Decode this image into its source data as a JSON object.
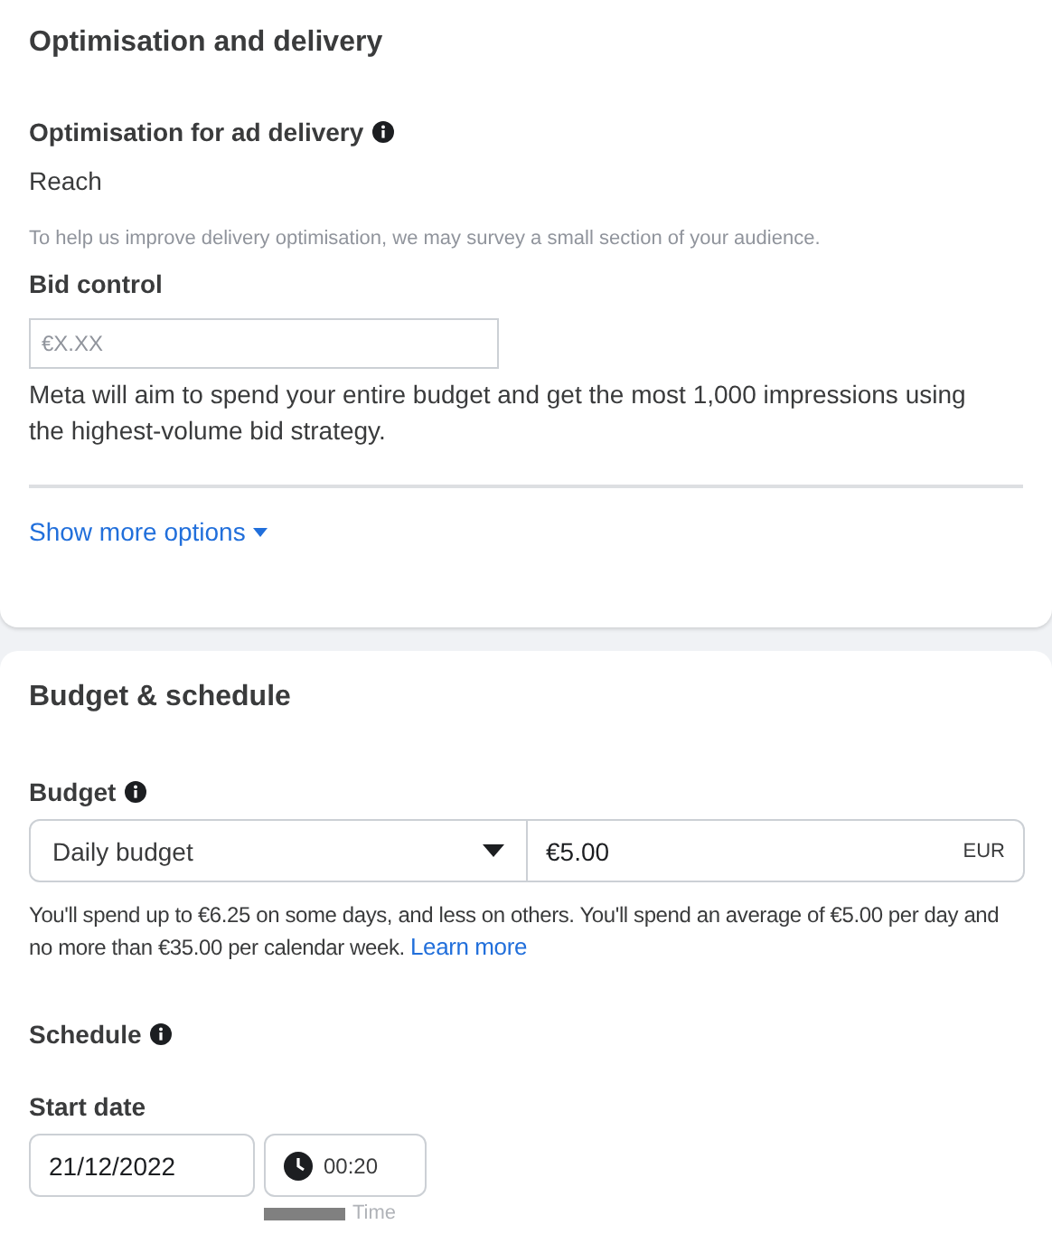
{
  "optimisation": {
    "title": "Optimisation and delivery",
    "goal_label": "Optimisation for ad delivery",
    "goal_value": "Reach",
    "survey_note": "To help us improve delivery optimisation, we may survey a small section of your audience.",
    "bid_label": "Bid control",
    "bid_placeholder": "€X.XX",
    "bid_description": "Meta will aim to spend your entire budget and get the most 1,000 impressions using the highest-volume bid strategy.",
    "more_link": "Show more options"
  },
  "budget_schedule": {
    "title": "Budget & schedule",
    "budget_label": "Budget",
    "budget_type": "Daily budget",
    "amount": "€5.00",
    "currency": "EUR",
    "spend_note": "You'll spend up to €6.25 on some days, and less on others. You'll spend an average of €5.00 per day and no more than €35.00 per calendar week.",
    "learn_more": "Learn more",
    "schedule_label": "Schedule",
    "start_label": "Start date",
    "start_date": "21/12/2022",
    "start_time": "00:20",
    "time_caption": "Time"
  }
}
